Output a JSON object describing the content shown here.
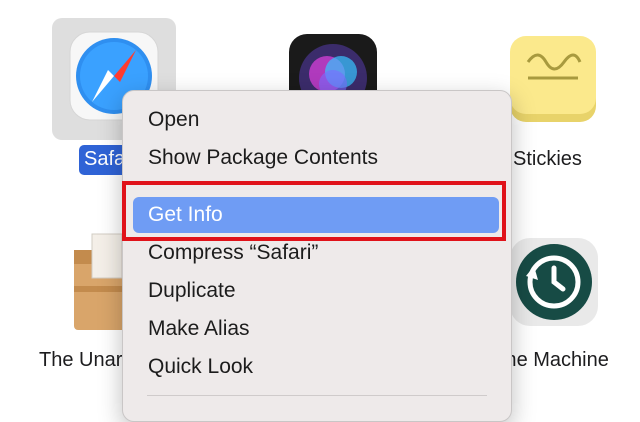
{
  "apps": {
    "safari_label": "Safari",
    "siri_label": "Siri",
    "stickies_label": "Stickies",
    "unarchiver_label": "The Unarchiver",
    "time_machine_label": "Time Machine"
  },
  "context_menu": {
    "items": [
      {
        "label": "Open"
      },
      {
        "label": "Show Package Contents"
      },
      {
        "label": "Get Info",
        "highlighted": true
      },
      {
        "label": "Compress “Safari”"
      },
      {
        "label": "Duplicate"
      },
      {
        "label": "Make Alias"
      },
      {
        "label": "Quick Look"
      }
    ]
  },
  "colors": {
    "highlight": "#6f9cf4",
    "annotation_box": "#e0121a",
    "selection_label": "#2f63d6"
  }
}
